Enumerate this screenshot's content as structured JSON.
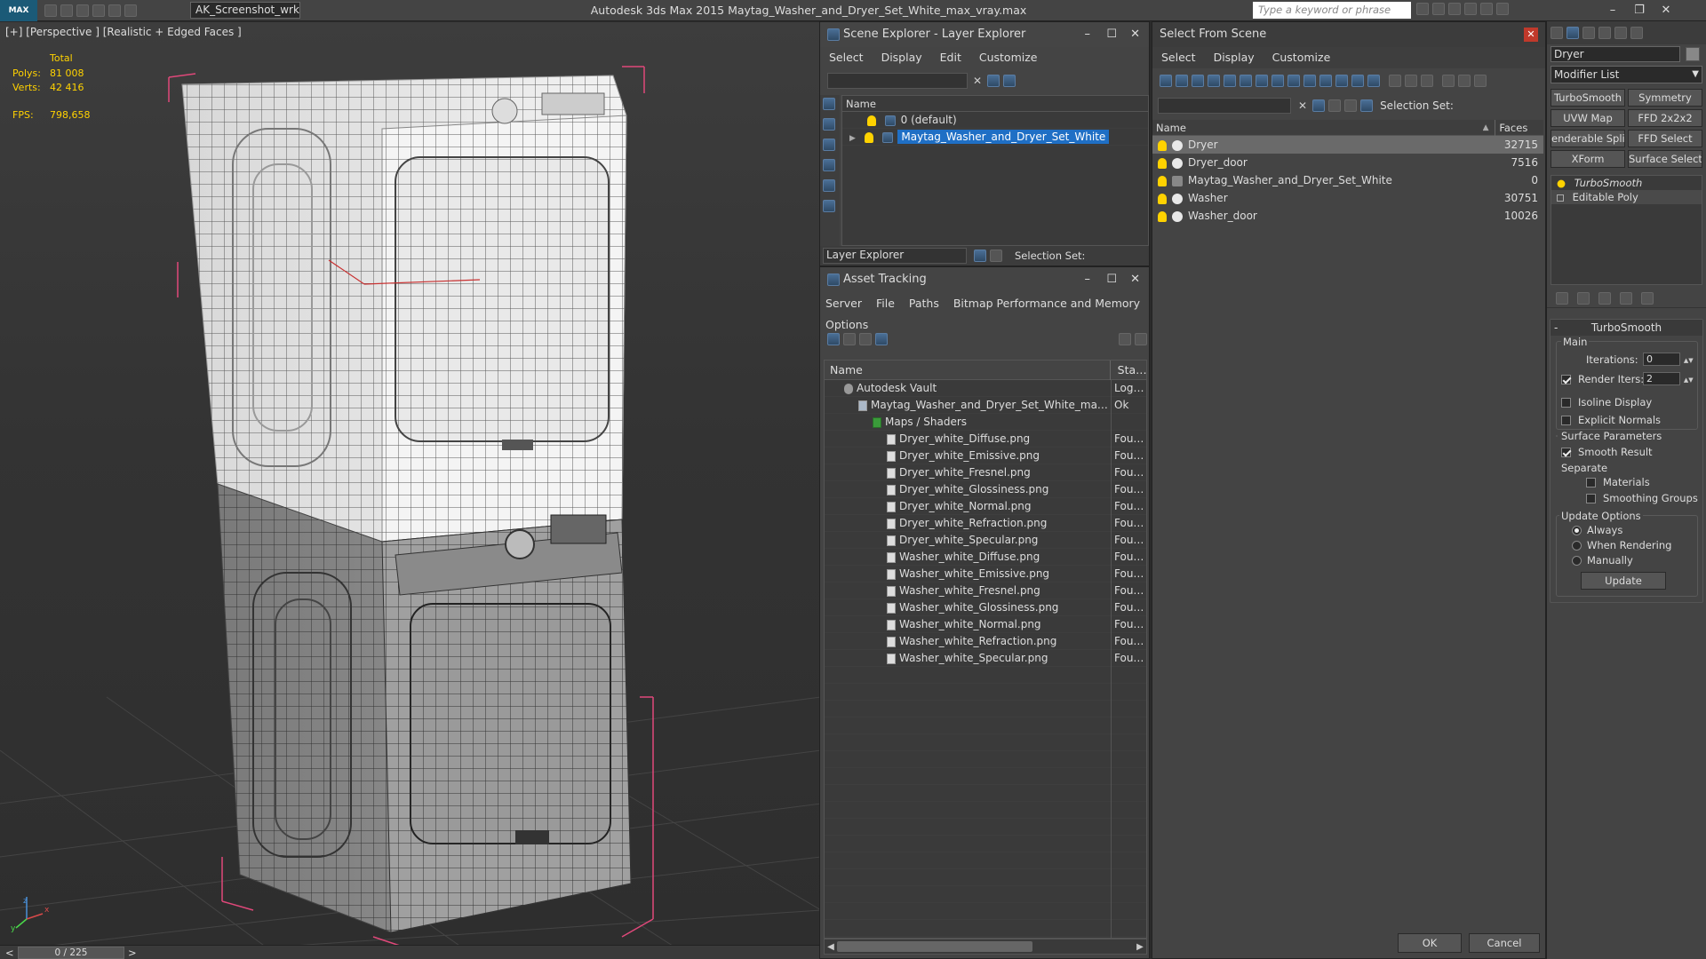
{
  "titlebar": {
    "logo_text": "MAX",
    "workspace": "AK_Screenshot_wrksp",
    "app_title": "Autodesk 3ds Max  2015    Maytag_Washer_and_Dryer_Set_White_max_vray.max",
    "search_placeholder": "Type a keyword or phrase"
  },
  "viewport": {
    "label": "[+] [Perspective ] [Realistic + Edged Faces ]",
    "stats": {
      "total_label": "Total",
      "polys_label": "Polys:",
      "polys_value": "81 008",
      "verts_label": "Verts:",
      "verts_value": "42 416",
      "fps_label": "FPS:",
      "fps_value": "798,658"
    },
    "axis_labels": {
      "x": "x",
      "y": "y",
      "z": "z"
    }
  },
  "timeslider": {
    "value": "0 / 225",
    "prev": "<",
    "next": ">"
  },
  "scene_explorer": {
    "title": "Scene Explorer - Layer Explorer",
    "menu": [
      "Select",
      "Display",
      "Edit",
      "Customize"
    ],
    "column_name": "Name",
    "layers": [
      {
        "name": "0 (default)",
        "selected": false
      },
      {
        "name": "Maytag_Washer_and_Dryer_Set_White",
        "selected": true
      }
    ],
    "footer_dropdown": "Layer Explorer",
    "footer_selection_set": "Selection Set:"
  },
  "asset_tracking": {
    "title": "Asset Tracking",
    "menu": [
      "Server",
      "File",
      "Paths",
      "Bitmap Performance and Memory",
      "Options"
    ],
    "columns": {
      "name": "Name",
      "status": "Status"
    },
    "rows": [
      {
        "name": "Autodesk Vault",
        "status": "Logge",
        "indent": 0,
        "kind": "vault"
      },
      {
        "name": "Maytag_Washer_and_Dryer_Set_White_max_vray...",
        "status": "Ok",
        "indent": 1,
        "kind": "max"
      },
      {
        "name": "Maps / Shaders",
        "status": "",
        "indent": 2,
        "kind": "maps"
      },
      {
        "name": "Dryer_white_Diffuse.png",
        "status": "Found",
        "indent": 3,
        "kind": "file"
      },
      {
        "name": "Dryer_white_Emissive.png",
        "status": "Found",
        "indent": 3,
        "kind": "file"
      },
      {
        "name": "Dryer_white_Fresnel.png",
        "status": "Found",
        "indent": 3,
        "kind": "file"
      },
      {
        "name": "Dryer_white_Glossiness.png",
        "status": "Found",
        "indent": 3,
        "kind": "file"
      },
      {
        "name": "Dryer_white_Normal.png",
        "status": "Found",
        "indent": 3,
        "kind": "file"
      },
      {
        "name": "Dryer_white_Refraction.png",
        "status": "Found",
        "indent": 3,
        "kind": "file"
      },
      {
        "name": "Dryer_white_Specular.png",
        "status": "Found",
        "indent": 3,
        "kind": "file"
      },
      {
        "name": "Washer_white_Diffuse.png",
        "status": "Found",
        "indent": 3,
        "kind": "file"
      },
      {
        "name": "Washer_white_Emissive.png",
        "status": "Found",
        "indent": 3,
        "kind": "file"
      },
      {
        "name": "Washer_white_Fresnel.png",
        "status": "Found",
        "indent": 3,
        "kind": "file"
      },
      {
        "name": "Washer_white_Glossiness.png",
        "status": "Found",
        "indent": 3,
        "kind": "file"
      },
      {
        "name": "Washer_white_Normal.png",
        "status": "Found",
        "indent": 3,
        "kind": "file"
      },
      {
        "name": "Washer_white_Refraction.png",
        "status": "Found",
        "indent": 3,
        "kind": "file"
      },
      {
        "name": "Washer_white_Specular.png",
        "status": "Found",
        "indent": 3,
        "kind": "file"
      }
    ]
  },
  "select_from_scene": {
    "title": "Select From Scene",
    "menu": [
      "Select",
      "Display",
      "Customize"
    ],
    "selection_set": "Selection Set:",
    "columns": {
      "name": "Name",
      "faces": "Faces"
    },
    "rows": [
      {
        "name": "Dryer",
        "faces": "32715",
        "selected": true,
        "kind": "object"
      },
      {
        "name": "Dryer_door",
        "faces": "7516",
        "selected": false,
        "kind": "object"
      },
      {
        "name": "Maytag_Washer_and_Dryer_Set_White",
        "faces": "0",
        "selected": false,
        "kind": "group"
      },
      {
        "name": "Washer",
        "faces": "30751",
        "selected": false,
        "kind": "object"
      },
      {
        "name": "Washer_door",
        "faces": "10026",
        "selected": false,
        "kind": "object"
      }
    ],
    "ok_label": "OK",
    "cancel_label": "Cancel"
  },
  "command_panel": {
    "object_name": "Dryer",
    "modifier_list": "Modifier List",
    "modifier_buttons": [
      "TurboSmooth",
      "Symmetry",
      "UVW Map",
      "FFD 2x2x2",
      "enderable Spli",
      "FFD Select",
      "XForm",
      "Surface Select"
    ],
    "stack": [
      {
        "name": "TurboSmooth",
        "italic": true
      },
      {
        "name": "Editable Poly",
        "italic": false
      }
    ],
    "rollout_title": "TurboSmooth",
    "main_label": "Main",
    "iterations_label": "Iterations:",
    "iterations_value": "0",
    "render_iters_label": "Render Iters:",
    "render_iters_value": "2",
    "isoline_label": "Isoline Display",
    "explicit_normals_label": "Explicit Normals",
    "surface_params_label": "Surface Parameters",
    "smooth_result_label": "Smooth Result",
    "separate_label": "Separate",
    "materials_label": "Materials",
    "smoothing_groups_label": "Smoothing Groups",
    "update_options_label": "Update Options",
    "always_label": "Always",
    "when_rendering_label": "When Rendering",
    "manually_label": "Manually",
    "update_button": "Update"
  },
  "colors": {
    "selection_blue": "#1f6fc5",
    "stat_yellow": "#ffd200",
    "bbox_pink": "#e0487a"
  }
}
